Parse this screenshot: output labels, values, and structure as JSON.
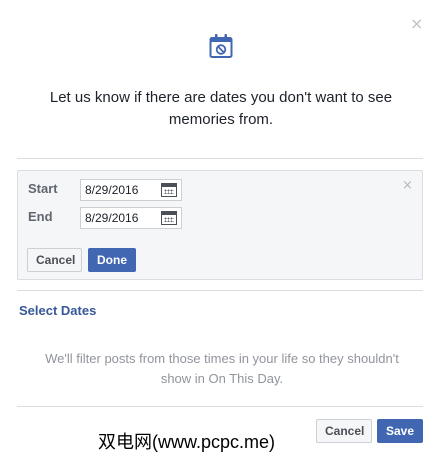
{
  "dialog": {
    "close_glyph": "×",
    "header_icon": "calendar-cancel-icon",
    "prompt": "Let us know if there are dates you don't want to see memories from."
  },
  "range_panel": {
    "close_glyph": "×",
    "start_label": "Start",
    "start_value": "8/29/2016",
    "end_label": "End",
    "end_value": "8/29/2016",
    "cancel_label": "Cancel",
    "done_label": "Done"
  },
  "select_dates_label": "Select Dates",
  "filter_note": "We'll filter posts from those times in your life so they shouldn't show in On This Day.",
  "watermark": "双电网(www.pcpc.me)",
  "footer": {
    "cancel_label": "Cancel",
    "save_label": "Save"
  },
  "colors": {
    "accent": "#4267b2",
    "link": "#385898",
    "muted_text": "#90949c",
    "panel_bg": "#f5f6f7",
    "border": "#dadde1"
  }
}
